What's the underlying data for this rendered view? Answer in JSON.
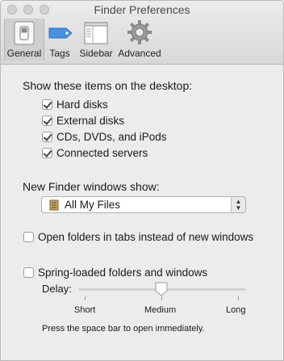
{
  "window": {
    "title": "Finder Preferences"
  },
  "toolbar": {
    "items": [
      {
        "label": "General",
        "icon": "general-switch-icon",
        "selected": true
      },
      {
        "label": "Tags",
        "icon": "tag-icon",
        "selected": false
      },
      {
        "label": "Sidebar",
        "icon": "sidebar-icon",
        "selected": false
      },
      {
        "label": "Advanced",
        "icon": "gear-icon",
        "selected": false
      }
    ]
  },
  "desktop": {
    "heading": "Show these items on the desktop:",
    "items": [
      {
        "label": "Hard disks",
        "checked": true
      },
      {
        "label": "External disks",
        "checked": true
      },
      {
        "label": "CDs, DVDs, and iPods",
        "checked": true
      },
      {
        "label": "Connected servers",
        "checked": true
      }
    ]
  },
  "new_window": {
    "label": "New Finder windows show:",
    "selected": "All My Files"
  },
  "tabs_option": {
    "label": "Open folders in tabs instead of new windows",
    "checked": false
  },
  "spring": {
    "label": "Spring-loaded folders and windows",
    "checked": false,
    "delay_label": "Delay:",
    "delay_level": 0.5,
    "ticks": [
      "Short",
      "Medium",
      "Long"
    ],
    "hint": "Press the space bar to open immediately."
  }
}
